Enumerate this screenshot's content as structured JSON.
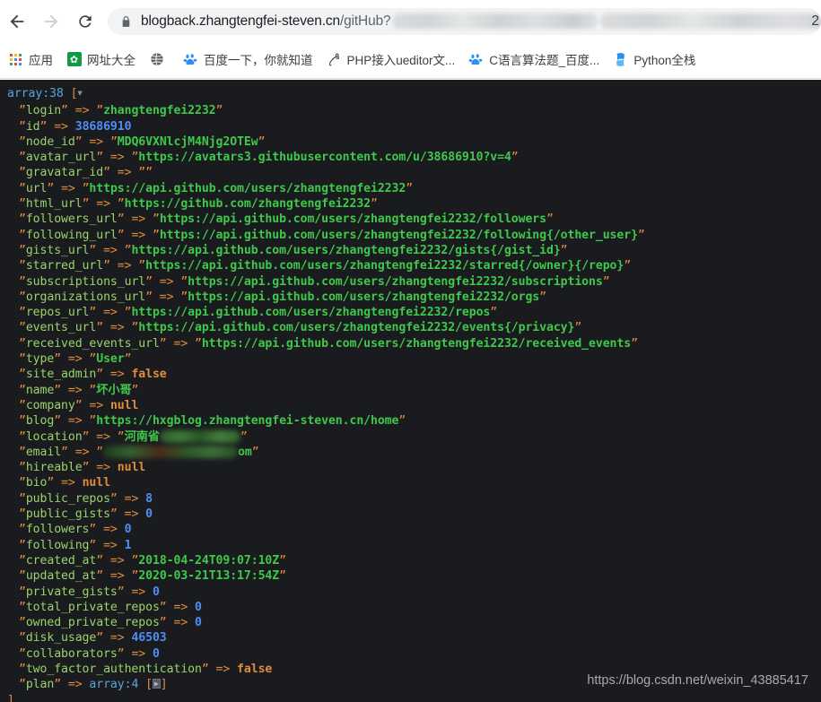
{
  "browser": {
    "nav": {
      "back_label": "Back",
      "forward_label": "Forward",
      "reload_label": "Reload"
    },
    "omnibox": {
      "lock_icon": "lock-icon",
      "url_visible": "blogback.zhangtengfei-steven.cn",
      "url_path": "/gitHub?",
      "url_redacted": true,
      "url_tail": "2"
    },
    "bookmarks": [
      {
        "icon": "apps-grid-icon",
        "label": "应用"
      },
      {
        "icon": "hao123-icon",
        "label": "网址大全"
      },
      {
        "icon": "globe-icon",
        "label": ""
      },
      {
        "icon": "baidu-paw-icon",
        "label": "百度一下，你就知道"
      },
      {
        "icon": "php-icon",
        "label": "PHP接入ueditor文..."
      },
      {
        "icon": "baidu-paw-icon",
        "label": "C语言算法题_百度..."
      },
      {
        "icon": "python-icon",
        "label": "Python全栈"
      }
    ]
  },
  "dump": {
    "header": {
      "type": "array",
      "count": "38",
      "open_bracket": "[",
      "close_bracket": "]"
    },
    "entries": [
      {
        "key": "login",
        "arrow": "=>",
        "value": "zhangtengfei2232",
        "kind": "string"
      },
      {
        "key": "id",
        "arrow": "=>",
        "value": "38686910",
        "kind": "number"
      },
      {
        "key": "node_id",
        "arrow": "=>",
        "value": "MDQ6VXNlcjM4Njg2OTEw",
        "kind": "string"
      },
      {
        "key": "avatar_url",
        "arrow": "=>",
        "value": "https://avatars3.githubusercontent.com/u/38686910?v=4",
        "kind": "string"
      },
      {
        "key": "gravatar_id",
        "arrow": "=>",
        "value": "",
        "kind": "string"
      },
      {
        "key": "url",
        "arrow": "=>",
        "value": "https://api.github.com/users/zhangtengfei2232",
        "kind": "string"
      },
      {
        "key": "html_url",
        "arrow": "=>",
        "value": "https://github.com/zhangtengfei2232",
        "kind": "string"
      },
      {
        "key": "followers_url",
        "arrow": "=>",
        "value": "https://api.github.com/users/zhangtengfei2232/followers",
        "kind": "string"
      },
      {
        "key": "following_url",
        "arrow": "=>",
        "value": "https://api.github.com/users/zhangtengfei2232/following{/other_user}",
        "kind": "string"
      },
      {
        "key": "gists_url",
        "arrow": "=>",
        "value": "https://api.github.com/users/zhangtengfei2232/gists{/gist_id}",
        "kind": "string"
      },
      {
        "key": "starred_url",
        "arrow": "=>",
        "value": "https://api.github.com/users/zhangtengfei2232/starred{/owner}{/repo}",
        "kind": "string"
      },
      {
        "key": "subscriptions_url",
        "arrow": "=>",
        "value": "https://api.github.com/users/zhangtengfei2232/subscriptions",
        "kind": "string"
      },
      {
        "key": "organizations_url",
        "arrow": "=>",
        "value": "https://api.github.com/users/zhangtengfei2232/orgs",
        "kind": "string"
      },
      {
        "key": "repos_url",
        "arrow": "=>",
        "value": "https://api.github.com/users/zhangtengfei2232/repos",
        "kind": "string"
      },
      {
        "key": "events_url",
        "arrow": "=>",
        "value": "https://api.github.com/users/zhangtengfei2232/events{/privacy}",
        "kind": "string"
      },
      {
        "key": "received_events_url",
        "arrow": "=>",
        "value": "https://api.github.com/users/zhangtengfei2232/received_events",
        "kind": "string"
      },
      {
        "key": "type",
        "arrow": "=>",
        "value": "User",
        "kind": "string"
      },
      {
        "key": "site_admin",
        "arrow": "=>",
        "value": "false",
        "kind": "keyword"
      },
      {
        "key": "name",
        "arrow": "=>",
        "value": "坏小哥",
        "kind": "string"
      },
      {
        "key": "company",
        "arrow": "=>",
        "value": "null",
        "kind": "keyword"
      },
      {
        "key": "blog",
        "arrow": "=>",
        "value": "https://hxgblog.zhangtengfei-steven.cn/home",
        "kind": "string"
      },
      {
        "key": "location",
        "arrow": "=>",
        "value": "河南省",
        "kind": "string-redacted",
        "redact_width": 90
      },
      {
        "key": "email",
        "arrow": "=>",
        "value": "om",
        "kind": "redacted-string",
        "redact_width": 150
      },
      {
        "key": "hireable",
        "arrow": "=>",
        "value": "null",
        "kind": "keyword"
      },
      {
        "key": "bio",
        "arrow": "=>",
        "value": "null",
        "kind": "keyword"
      },
      {
        "key": "public_repos",
        "arrow": "=>",
        "value": "8",
        "kind": "number"
      },
      {
        "key": "public_gists",
        "arrow": "=>",
        "value": "0",
        "kind": "number"
      },
      {
        "key": "followers",
        "arrow": "=>",
        "value": "0",
        "kind": "number"
      },
      {
        "key": "following",
        "arrow": "=>",
        "value": "1",
        "kind": "number"
      },
      {
        "key": "created_at",
        "arrow": "=>",
        "value": "2018-04-24T09:07:10Z",
        "kind": "string"
      },
      {
        "key": "updated_at",
        "arrow": "=>",
        "value": "2020-03-21T13:17:54Z",
        "kind": "string"
      },
      {
        "key": "private_gists",
        "arrow": "=>",
        "value": "0",
        "kind": "number"
      },
      {
        "key": "total_private_repos",
        "arrow": "=>",
        "value": "0",
        "kind": "number"
      },
      {
        "key": "owned_private_repos",
        "arrow": "=>",
        "value": "0",
        "kind": "number"
      },
      {
        "key": "disk_usage",
        "arrow": "=>",
        "value": "46503",
        "kind": "number"
      },
      {
        "key": "collaborators",
        "arrow": "=>",
        "value": "0",
        "kind": "number"
      },
      {
        "key": "two_factor_authentication",
        "arrow": "=>",
        "value": "false",
        "kind": "keyword"
      },
      {
        "key": "plan",
        "arrow": "=>",
        "value": "array:4",
        "kind": "nested",
        "nested_count": "4"
      }
    ]
  },
  "watermark": {
    "text": "https://blog.csdn.net/weixin_43885417"
  },
  "colors": {
    "console_bg": "#1a1b1f",
    "key": "#9ad36a",
    "string": "#3fc84a",
    "number": "#4d8ef7",
    "keyword": "#e08c3b",
    "header": "#59a5d8",
    "chrome_bg": "#ffffff",
    "omnibox_bg": "#f1f3f4"
  }
}
